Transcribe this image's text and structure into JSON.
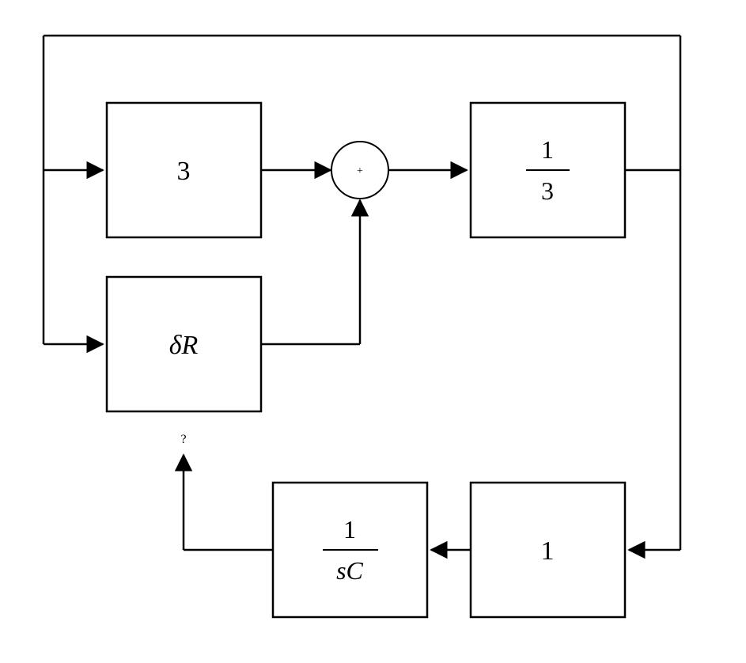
{
  "diagram": {
    "blocks": {
      "gain3": {
        "label": "3"
      },
      "deltaR": {
        "label": "δR"
      },
      "frac_1_3": {
        "num": "1",
        "den": "3"
      },
      "frac_1_sC": {
        "num": "1",
        "den": "sC"
      },
      "gain1": {
        "label": "1"
      }
    },
    "sum": {
      "symbol": "+"
    },
    "annotations": {
      "question": "?"
    }
  },
  "chart_data": {
    "type": "block-diagram",
    "nodes": [
      {
        "id": "split",
        "kind": "branch"
      },
      {
        "id": "gain3",
        "kind": "gain",
        "value": "3"
      },
      {
        "id": "deltaR",
        "kind": "gain",
        "value": "δR"
      },
      {
        "id": "sum",
        "kind": "sum",
        "op": "+"
      },
      {
        "id": "frac13",
        "kind": "transfer",
        "value": "1/3"
      },
      {
        "id": "gain1",
        "kind": "gain",
        "value": "1"
      },
      {
        "id": "frac1sC",
        "kind": "transfer",
        "value": "1/(sC)"
      },
      {
        "id": "out_q",
        "kind": "terminal",
        "label": "?"
      }
    ],
    "edges": [
      {
        "from": "split",
        "to": "gain3"
      },
      {
        "from": "split",
        "to": "deltaR"
      },
      {
        "from": "gain3",
        "to": "sum"
      },
      {
        "from": "deltaR",
        "to": "sum"
      },
      {
        "from": "sum",
        "to": "frac13"
      },
      {
        "from": "frac13",
        "to": "gain1",
        "via": "right-down"
      },
      {
        "from": "gain1",
        "to": "frac1sC"
      },
      {
        "from": "frac1sC",
        "to": "out_q"
      },
      {
        "from": "out_q",
        "to": "split",
        "note": "feedback path (top loop)",
        "implied": true
      }
    ]
  }
}
